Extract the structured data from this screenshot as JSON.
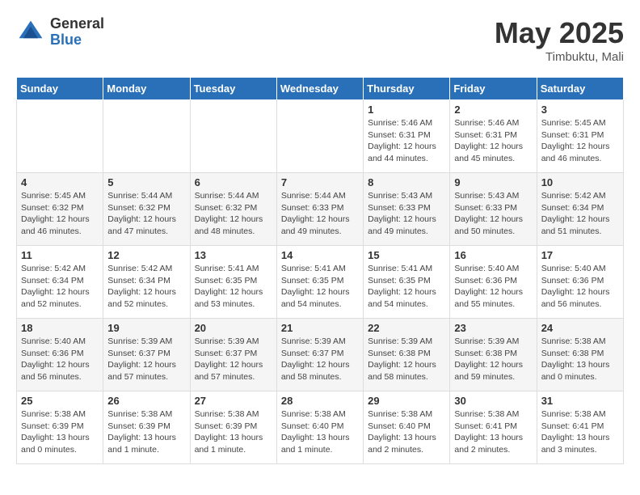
{
  "header": {
    "logo_general": "General",
    "logo_blue": "Blue",
    "month_title": "May 2025",
    "location": "Timbuktu, Mali"
  },
  "weekdays": [
    "Sunday",
    "Monday",
    "Tuesday",
    "Wednesday",
    "Thursday",
    "Friday",
    "Saturday"
  ],
  "weeks": [
    [
      {
        "day": "",
        "content": ""
      },
      {
        "day": "",
        "content": ""
      },
      {
        "day": "",
        "content": ""
      },
      {
        "day": "",
        "content": ""
      },
      {
        "day": "1",
        "content": "Sunrise: 5:46 AM\nSunset: 6:31 PM\nDaylight: 12 hours\nand 44 minutes."
      },
      {
        "day": "2",
        "content": "Sunrise: 5:46 AM\nSunset: 6:31 PM\nDaylight: 12 hours\nand 45 minutes."
      },
      {
        "day": "3",
        "content": "Sunrise: 5:45 AM\nSunset: 6:31 PM\nDaylight: 12 hours\nand 46 minutes."
      }
    ],
    [
      {
        "day": "4",
        "content": "Sunrise: 5:45 AM\nSunset: 6:32 PM\nDaylight: 12 hours\nand 46 minutes."
      },
      {
        "day": "5",
        "content": "Sunrise: 5:44 AM\nSunset: 6:32 PM\nDaylight: 12 hours\nand 47 minutes."
      },
      {
        "day": "6",
        "content": "Sunrise: 5:44 AM\nSunset: 6:32 PM\nDaylight: 12 hours\nand 48 minutes."
      },
      {
        "day": "7",
        "content": "Sunrise: 5:44 AM\nSunset: 6:33 PM\nDaylight: 12 hours\nand 49 minutes."
      },
      {
        "day": "8",
        "content": "Sunrise: 5:43 AM\nSunset: 6:33 PM\nDaylight: 12 hours\nand 49 minutes."
      },
      {
        "day": "9",
        "content": "Sunrise: 5:43 AM\nSunset: 6:33 PM\nDaylight: 12 hours\nand 50 minutes."
      },
      {
        "day": "10",
        "content": "Sunrise: 5:42 AM\nSunset: 6:34 PM\nDaylight: 12 hours\nand 51 minutes."
      }
    ],
    [
      {
        "day": "11",
        "content": "Sunrise: 5:42 AM\nSunset: 6:34 PM\nDaylight: 12 hours\nand 52 minutes."
      },
      {
        "day": "12",
        "content": "Sunrise: 5:42 AM\nSunset: 6:34 PM\nDaylight: 12 hours\nand 52 minutes."
      },
      {
        "day": "13",
        "content": "Sunrise: 5:41 AM\nSunset: 6:35 PM\nDaylight: 12 hours\nand 53 minutes."
      },
      {
        "day": "14",
        "content": "Sunrise: 5:41 AM\nSunset: 6:35 PM\nDaylight: 12 hours\nand 54 minutes."
      },
      {
        "day": "15",
        "content": "Sunrise: 5:41 AM\nSunset: 6:35 PM\nDaylight: 12 hours\nand 54 minutes."
      },
      {
        "day": "16",
        "content": "Sunrise: 5:40 AM\nSunset: 6:36 PM\nDaylight: 12 hours\nand 55 minutes."
      },
      {
        "day": "17",
        "content": "Sunrise: 5:40 AM\nSunset: 6:36 PM\nDaylight: 12 hours\nand 56 minutes."
      }
    ],
    [
      {
        "day": "18",
        "content": "Sunrise: 5:40 AM\nSunset: 6:36 PM\nDaylight: 12 hours\nand 56 minutes."
      },
      {
        "day": "19",
        "content": "Sunrise: 5:39 AM\nSunset: 6:37 PM\nDaylight: 12 hours\nand 57 minutes."
      },
      {
        "day": "20",
        "content": "Sunrise: 5:39 AM\nSunset: 6:37 PM\nDaylight: 12 hours\nand 57 minutes."
      },
      {
        "day": "21",
        "content": "Sunrise: 5:39 AM\nSunset: 6:37 PM\nDaylight: 12 hours\nand 58 minutes."
      },
      {
        "day": "22",
        "content": "Sunrise: 5:39 AM\nSunset: 6:38 PM\nDaylight: 12 hours\nand 58 minutes."
      },
      {
        "day": "23",
        "content": "Sunrise: 5:39 AM\nSunset: 6:38 PM\nDaylight: 12 hours\nand 59 minutes."
      },
      {
        "day": "24",
        "content": "Sunrise: 5:38 AM\nSunset: 6:38 PM\nDaylight: 13 hours\nand 0 minutes."
      }
    ],
    [
      {
        "day": "25",
        "content": "Sunrise: 5:38 AM\nSunset: 6:39 PM\nDaylight: 13 hours\nand 0 minutes."
      },
      {
        "day": "26",
        "content": "Sunrise: 5:38 AM\nSunset: 6:39 PM\nDaylight: 13 hours\nand 1 minute."
      },
      {
        "day": "27",
        "content": "Sunrise: 5:38 AM\nSunset: 6:39 PM\nDaylight: 13 hours\nand 1 minute."
      },
      {
        "day": "28",
        "content": "Sunrise: 5:38 AM\nSunset: 6:40 PM\nDaylight: 13 hours\nand 1 minute."
      },
      {
        "day": "29",
        "content": "Sunrise: 5:38 AM\nSunset: 6:40 PM\nDaylight: 13 hours\nand 2 minutes."
      },
      {
        "day": "30",
        "content": "Sunrise: 5:38 AM\nSunset: 6:41 PM\nDaylight: 13 hours\nand 2 minutes."
      },
      {
        "day": "31",
        "content": "Sunrise: 5:38 AM\nSunset: 6:41 PM\nDaylight: 13 hours\nand 3 minutes."
      }
    ]
  ]
}
